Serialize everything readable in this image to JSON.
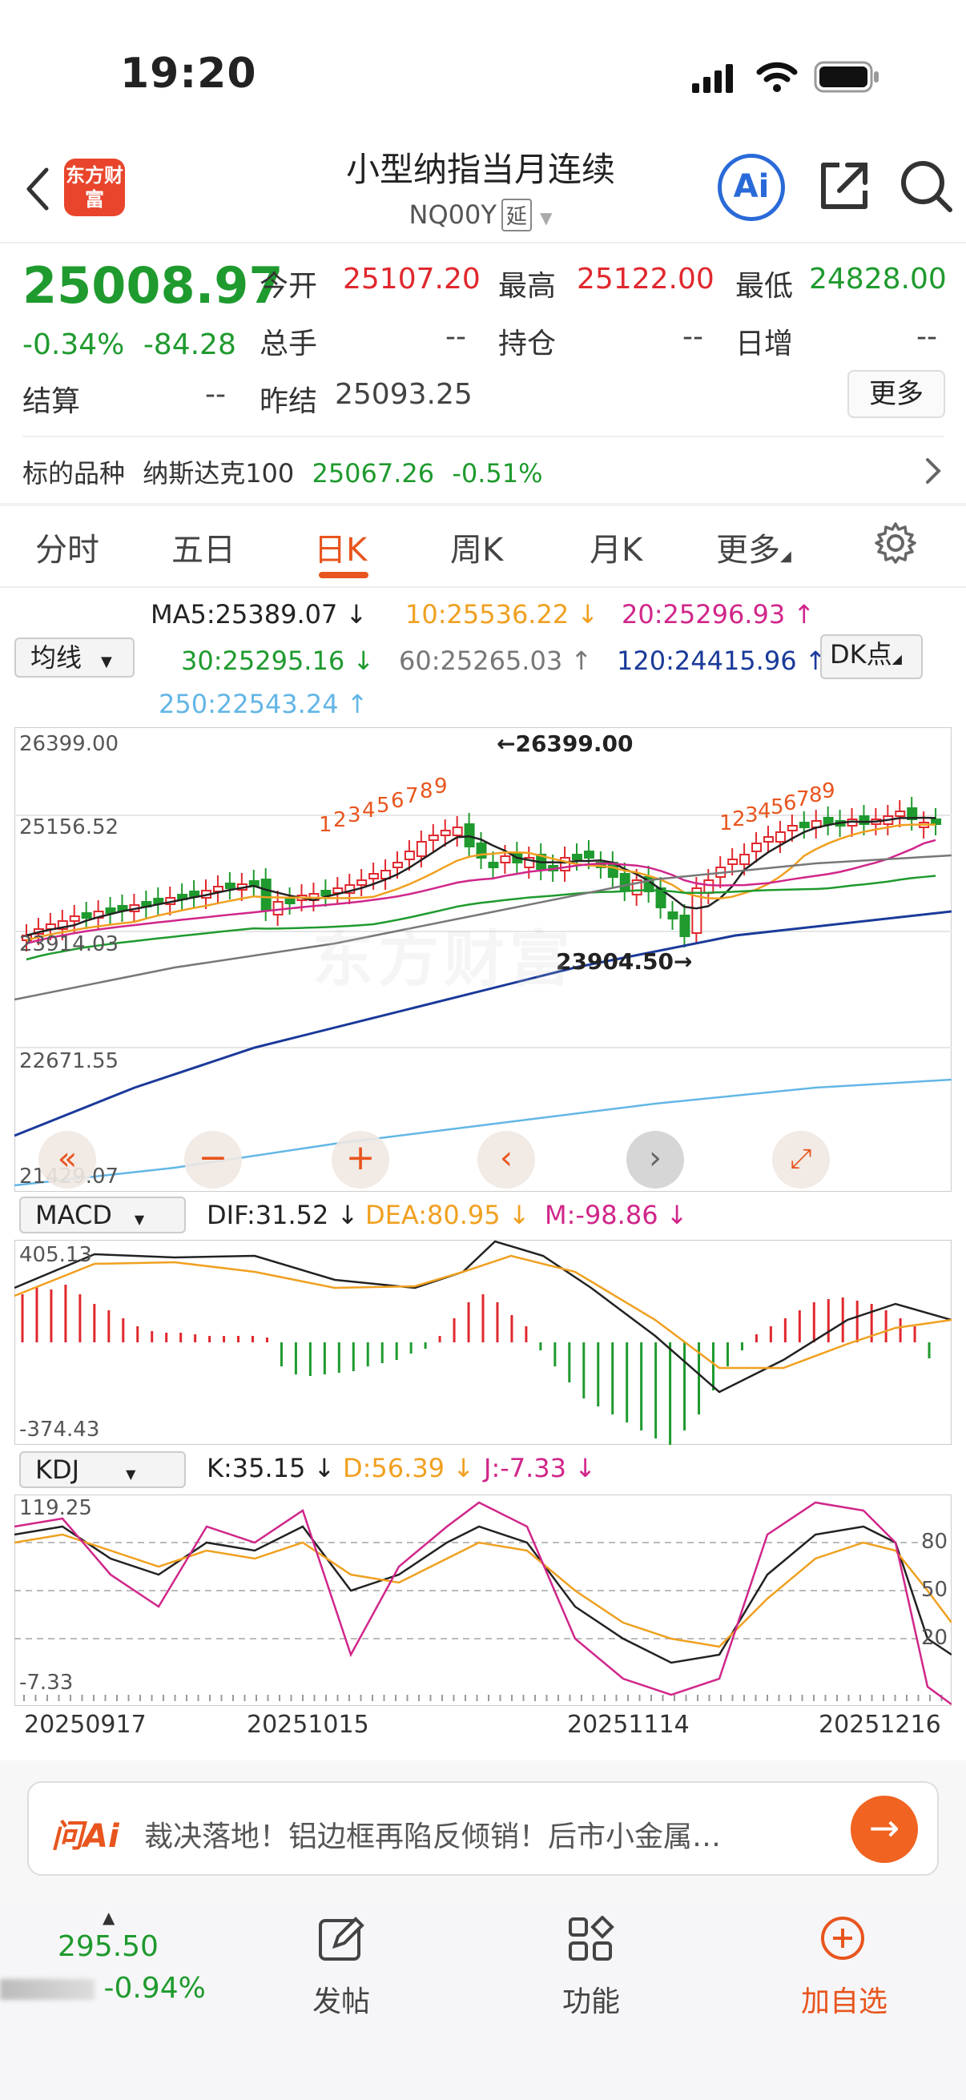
{
  "status": {
    "time": "19:20"
  },
  "header": {
    "logo_text": "东方财富",
    "title": "小型纳指当月连续",
    "code": "NQ00Y",
    "delay_badge": "延",
    "ai_label": "Ai"
  },
  "quote": {
    "price": "25008.97",
    "change_pct": "-0.34%",
    "change_abs": "-84.28",
    "fields": [
      {
        "label": "今开",
        "value": "25107.20"
      },
      {
        "label": "最高",
        "value": "25122.00"
      },
      {
        "label": "最低",
        "value": "24828.00"
      },
      {
        "label": "总手",
        "value": "--"
      },
      {
        "label": "持仓",
        "value": "--"
      },
      {
        "label": "日增",
        "value": "--"
      },
      {
        "label": "结算",
        "value": "--"
      },
      {
        "label": "昨结",
        "value": "25093.25"
      }
    ],
    "more_label": "更多",
    "underlying_label": "标的品种",
    "underlying_name": "纳斯达克100",
    "underlying_price": "25067.26",
    "underlying_pct": "-0.51%"
  },
  "tabs": [
    {
      "label": "分时"
    },
    {
      "label": "五日"
    },
    {
      "label": "日K"
    },
    {
      "label": "周K"
    },
    {
      "label": "月K"
    },
    {
      "label": "更多"
    }
  ],
  "ma": {
    "select_label": "均线",
    "dk_label": "DK点",
    "items": [
      {
        "text": "MA5:25389.07 ↓",
        "color": "#222222"
      },
      {
        "text": "10:25536.22 ↓",
        "color": "#f0a020"
      },
      {
        "text": "20:25296.93 ↑",
        "color": "#d0268a"
      },
      {
        "text": "30:25295.16 ↓",
        "color": "#1f9a2e"
      },
      {
        "text": "60:25265.03 ↑",
        "color": "#777777"
      },
      {
        "text": "120:24415.96 ↑",
        "color": "#1a3a9a"
      },
      {
        "text": "250:22543.24 ↑",
        "color": "#63b6e6"
      }
    ]
  },
  "kline": {
    "y_labels": [
      "26399.00",
      "25156.52",
      "23914.03",
      "22671.55",
      "21429.07"
    ],
    "high_marker": "26399.00",
    "low_marker": "23904.50",
    "watermark": "东方财富",
    "counts_left": [
      "1",
      "2",
      "3",
      "4",
      "5",
      "6",
      "7",
      "8",
      "9"
    ],
    "counts_right": [
      "1",
      "2",
      "3",
      "4",
      "5",
      "6",
      "7",
      "8",
      "9"
    ]
  },
  "macd": {
    "select_label": "MACD",
    "dif": "DIF:31.52 ↓",
    "dea": "DEA:80.95 ↓",
    "m": "M:-98.86 ↓",
    "y_top": "405.13",
    "y_bottom": "-374.43"
  },
  "kdj": {
    "select_label": "KDJ",
    "k": "K:35.15 ↓",
    "d": "D:56.39 ↓",
    "j": "J:-7.33 ↓",
    "y_top": "119.25",
    "y_bottom": "-7.33",
    "levels": [
      "80",
      "50",
      "20"
    ]
  },
  "dates": [
    "20250917",
    "20251015",
    "20251114",
    "20251216"
  ],
  "ai_bar": {
    "brand": "问Ai",
    "text": "裁决落地！铝边框再陷反倾销！后市小金属…"
  },
  "bottom": {
    "ticker_price": "295.50",
    "ticker_pct": "-0.94%",
    "nav": [
      {
        "label": "发帖"
      },
      {
        "label": "功能"
      },
      {
        "label": "加自选"
      }
    ]
  }
}
